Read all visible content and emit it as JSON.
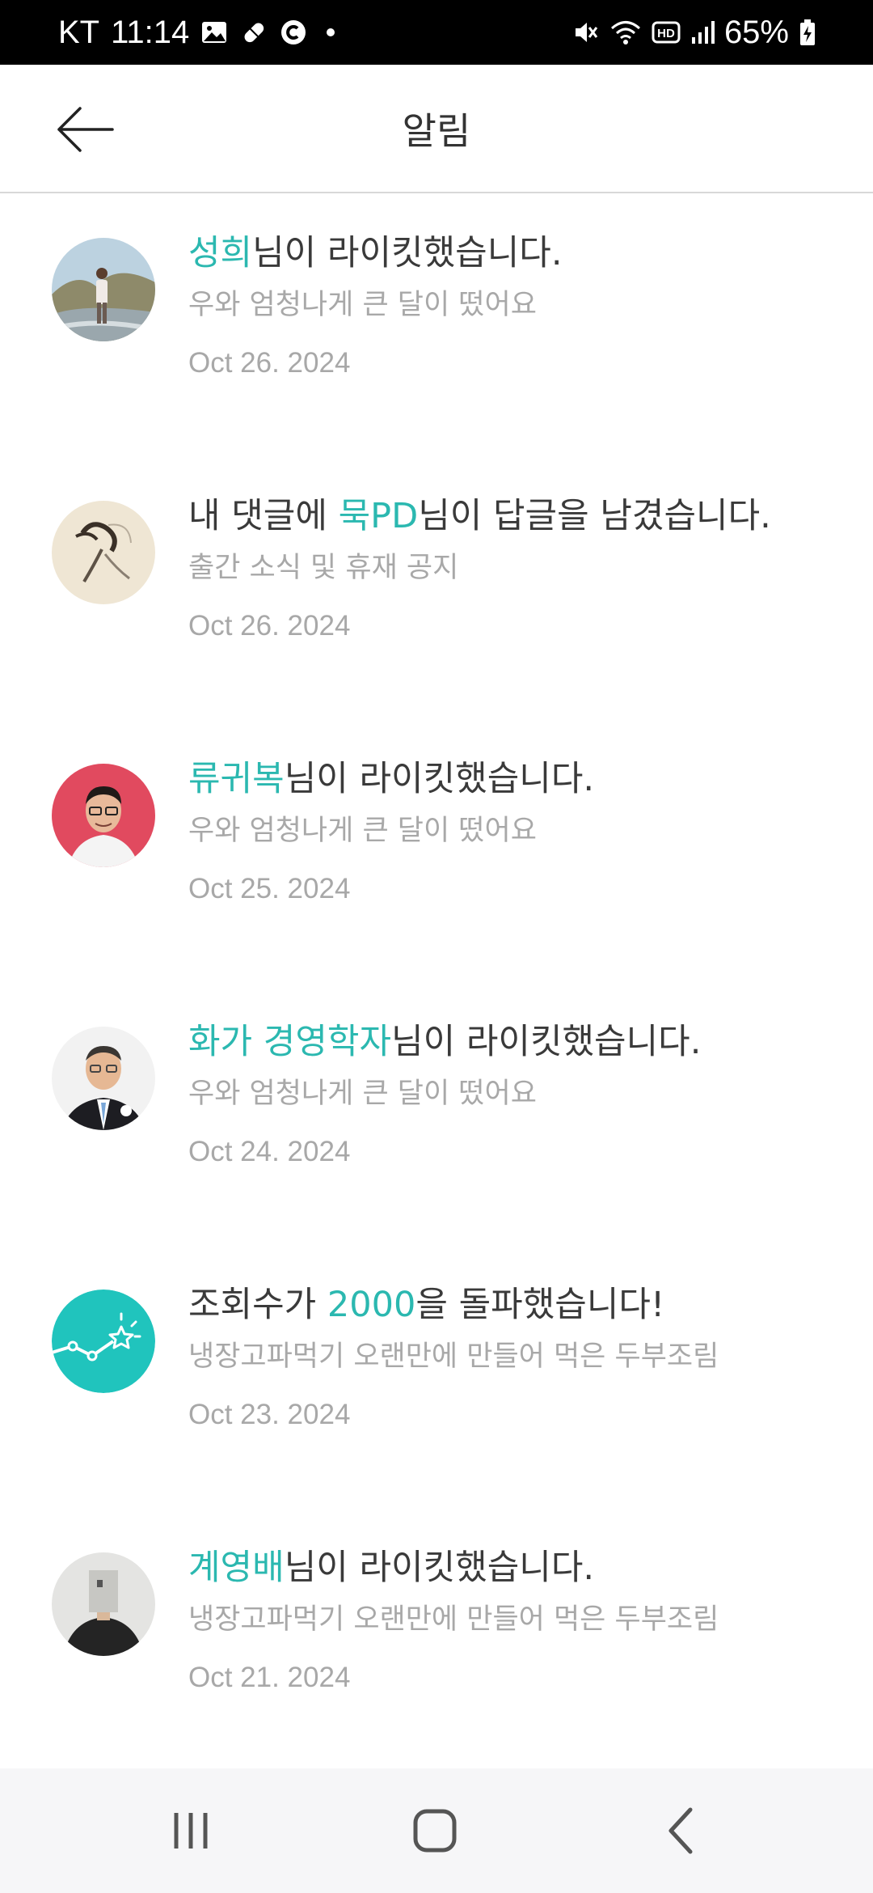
{
  "status_bar": {
    "carrier": "KT",
    "time": "11:14",
    "battery": "65%",
    "icons": [
      "image-icon",
      "pill-icon",
      "c-circle-icon",
      "dot-icon",
      "mute-icon",
      "wifi-icon",
      "hd-icon",
      "signal-icon",
      "battery-charging-icon"
    ]
  },
  "header": {
    "title": "알림",
    "back_icon": "back-arrow-icon"
  },
  "notifications": [
    {
      "pre": "",
      "highlight": "성희",
      "post": "님이 라이킷했습니다.",
      "subtitle": "우와 엄청나게 큰 달이 떴어요",
      "date": "Oct 26. 2024"
    },
    {
      "pre": "내 댓글에 ",
      "highlight": "묵PD",
      "post": "님이 답글을 남겼습니다.",
      "subtitle": "출간 소식 및 휴재 공지",
      "date": "Oct 26. 2024"
    },
    {
      "pre": "",
      "highlight": "류귀복",
      "post": "님이 라이킷했습니다.",
      "subtitle": "우와 엄청나게 큰 달이 떴어요",
      "date": "Oct 25. 2024"
    },
    {
      "pre": "",
      "highlight": "화가 경영학자",
      "post": "님이 라이킷했습니다.",
      "subtitle": "우와 엄청나게 큰 달이 떴어요",
      "date": "Oct 24. 2024"
    },
    {
      "pre": "조회수가 ",
      "highlight": "2000",
      "post": "을 돌파했습니다!",
      "subtitle": "냉장고파먹기 오랜만에 만들어 먹은 두부조림",
      "date": "Oct 23. 2024"
    },
    {
      "pre": "",
      "highlight": "계영배",
      "post": "님이 라이킷했습니다.",
      "subtitle": "냉장고파먹기 오랜만에 만들어 먹은 두부조림",
      "date": "Oct 21. 2024"
    }
  ],
  "colors": {
    "accent": "#2bb8b0",
    "title_text": "#3a3a3a",
    "secondary_text": "#a8a8a8"
  },
  "nav_bar": {
    "icons": [
      "recent-apps-icon",
      "home-icon",
      "back-icon"
    ]
  }
}
